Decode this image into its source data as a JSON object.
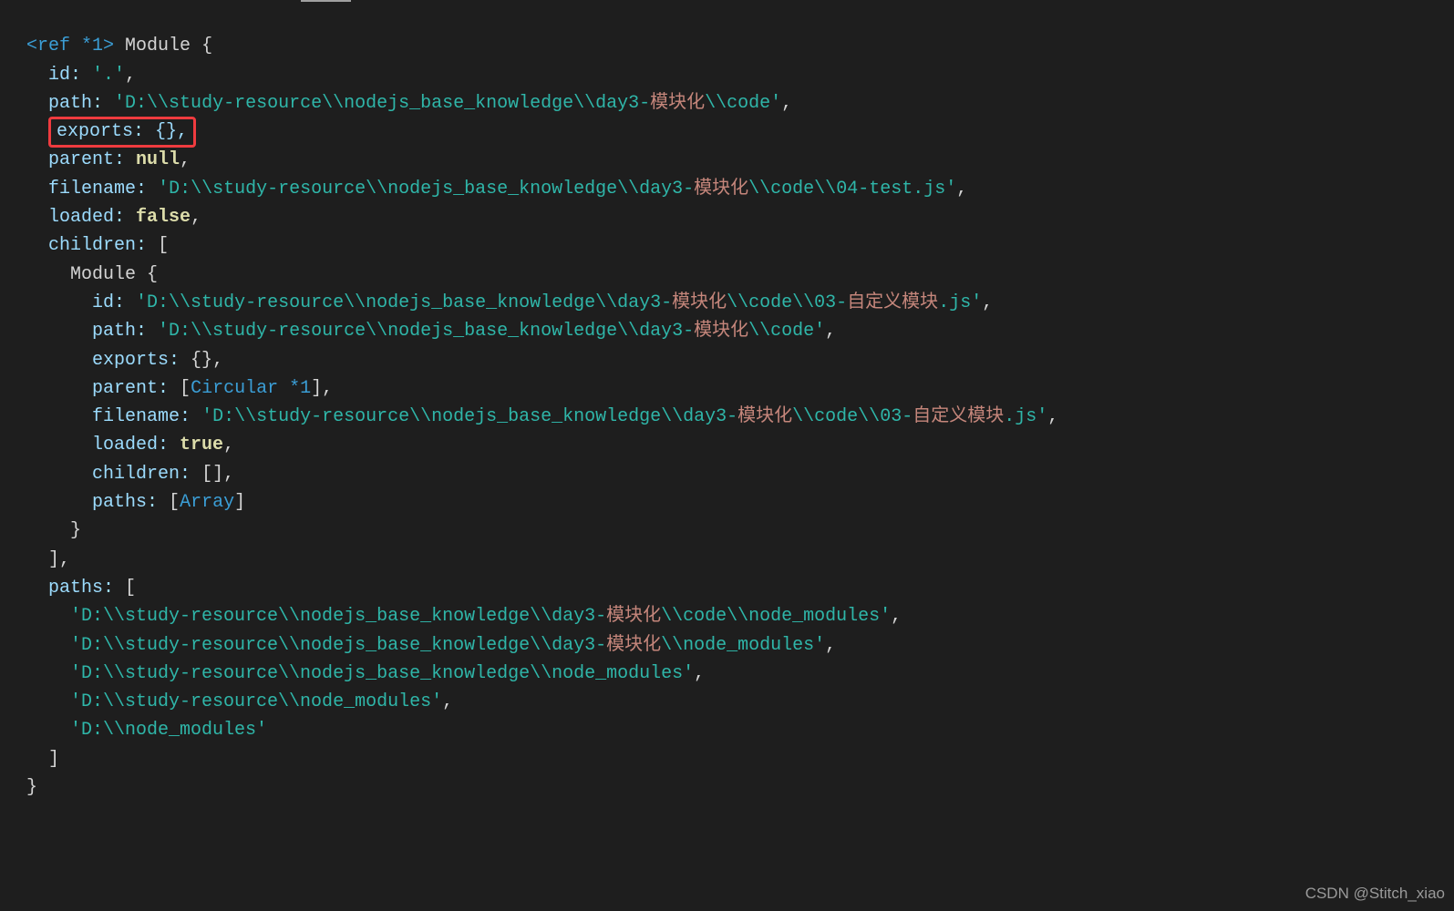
{
  "ref_tag": "<ref *1>",
  "module_word": "Module",
  "brace_open": "{",
  "brace_close": "}",
  "top": {
    "id_key": "id:",
    "id_val": "'.'",
    "path_key": "path:",
    "path_val_a": "'D:\\\\study-resource\\\\nodejs_base_knowledge\\\\day3-",
    "path_val_cn": "模块化",
    "path_val_b": "\\\\code'",
    "exports_full": "exports: {},",
    "parent_key": "parent:",
    "parent_val": "null",
    "filename_key": "filename:",
    "filename_val_a": "'D:\\\\study-resource\\\\nodejs_base_knowledge\\\\day3-",
    "filename_val_cn": "模块化",
    "filename_val_b": "\\\\code\\\\04-test.js'",
    "loaded_key": "loaded:",
    "loaded_val": "false",
    "children_key": "children:",
    "bracket_open": "[",
    "bracket_close": "]",
    "paths_key": "paths:"
  },
  "child": {
    "id_key": "id:",
    "id_val_a": "'D:\\\\study-resource\\\\nodejs_base_knowledge\\\\day3-",
    "id_val_cn": "模块化",
    "id_val_b": "\\\\code\\\\03-",
    "id_val_cn2": "自定义模块",
    "id_val_c": ".js'",
    "path_key": "path:",
    "path_val_a": "'D:\\\\study-resource\\\\nodejs_base_knowledge\\\\day3-",
    "path_val_cn": "模块化",
    "path_val_b": "\\\\code'",
    "exports_key": "exports:",
    "exports_val": "{}",
    "parent_key": "parent:",
    "parent_bracket_l": "[",
    "parent_circular": "Circular *1",
    "parent_bracket_r": "]",
    "filename_key": "filename:",
    "filename_val_a": "'D:\\\\study-resource\\\\nodejs_base_knowledge\\\\day3-",
    "filename_val_cn": "模块化",
    "filename_val_b": "\\\\code\\\\03-",
    "filename_val_cn2": "自定义模块",
    "filename_val_c": ".js'",
    "loaded_key": "loaded:",
    "loaded_val": "true",
    "children_key": "children:",
    "children_val": "[]",
    "paths_key": "paths:",
    "paths_bracket_l": "[",
    "paths_array": "Array",
    "paths_bracket_r": "]"
  },
  "paths": {
    "p0a": "'D:\\\\study-resource\\\\nodejs_base_knowledge\\\\day3-",
    "p0cn": "模块化",
    "p0b": "\\\\code\\\\node_modules'",
    "p1a": "'D:\\\\study-resource\\\\nodejs_base_knowledge\\\\day3-",
    "p1cn": "模块化",
    "p1b": "\\\\node_modules'",
    "p2": "'D:\\\\study-resource\\\\nodejs_base_knowledge\\\\node_modules'",
    "p3": "'D:\\\\study-resource\\\\node_modules'",
    "p4": "'D:\\\\node_modules'"
  },
  "comma": ",",
  "watermark": "CSDN @Stitch_xiao"
}
